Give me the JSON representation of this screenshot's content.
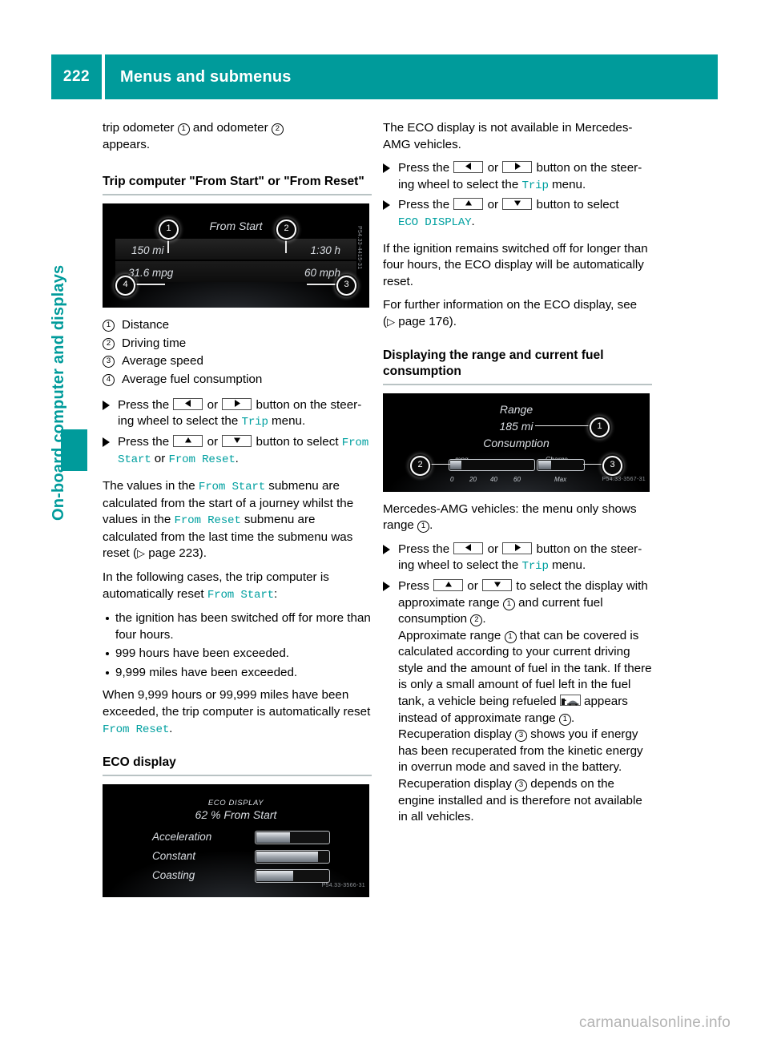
{
  "header": {
    "page_number": "222",
    "title": "Menus and submenus"
  },
  "side_tab": {
    "label": "On-board computer and displays"
  },
  "footer": {
    "watermark": "carmanualsonline.info"
  },
  "left_column": {
    "intro": {
      "part1": "trip odometer ",
      "marker1": "1",
      "part2": " and odometer ",
      "marker2": "2",
      "part3": "",
      "line2": "appears."
    },
    "heading_trip": "Trip computer \"From Start\" or \"From Reset\"",
    "trip_shot": {
      "title": "From Start",
      "distance": "150 mi",
      "time": "1:30 h",
      "economy": "31.6 mpg",
      "speed": "60 mph",
      "bubble_1": "1",
      "bubble_2": "2",
      "bubble_3": "3",
      "bubble_4": "4",
      "image_id": "P54.33-4415-31"
    },
    "legend": [
      {
        "marker": "1",
        "label": "Distance"
      },
      {
        "marker": "2",
        "label": "Driving time"
      },
      {
        "marker": "3",
        "label": "Average speed"
      },
      {
        "marker": "4",
        "label": "Average fuel consumption"
      }
    ],
    "step_trip_menu": {
      "t1": "Press the ",
      "t2": " or ",
      "t3": " button on the steer-ing wheel to select the ",
      "menu": "Trip",
      "t4": " menu."
    },
    "step_trip_select": {
      "t1": "Press the ",
      "t2": " or ",
      "t3": " button to select ",
      "menu1": "From Start",
      "t4": " or ",
      "menu2": "From Reset",
      "t5": "."
    },
    "para_values": {
      "t1": "The values in the ",
      "m1": "From Start",
      "t2": " submenu are calculated from the start of a journey whilst the values in the ",
      "m2": "From Reset",
      "t3": " submenu are calculated from the last time the submenu was reset (",
      "ref": "page 223",
      "t4": ")."
    },
    "para_cases": {
      "t1": "In the following cases, the trip computer is automatically reset ",
      "m1": "From Start",
      "t2": ":"
    },
    "bullets": [
      "the ignition has been switched off for more than four hours.",
      "999 hours have been exceeded.",
      "9,999 miles have been exceeded."
    ],
    "para_when": {
      "t1": "When 9,999 hours or 99,999 miles have been exceeded, the trip computer is automatically reset ",
      "m1": "From Reset",
      "t2": "."
    },
    "heading_eco": "ECO display",
    "eco_shot": {
      "title": "ECO DISPLAY",
      "subtitle": "62 % From Start",
      "rows": [
        {
          "label": "Acceleration",
          "fill_percent": 46
        },
        {
          "label": "Constant",
          "fill_percent": 84
        },
        {
          "label": "Coasting",
          "fill_percent": 50
        }
      ],
      "image_id": "P54.33-3566-31"
    }
  },
  "right_column": {
    "para_amg": "The ECO display is not available in Mercedes-AMG vehicles.",
    "step_trip_menu": {
      "t1": "Press the ",
      "t2": " or ",
      "t3": " button on the steer-ing wheel to select the ",
      "menu": "Trip",
      "t4": " menu."
    },
    "step_eco_select": {
      "t1": "Press the ",
      "t2": " or ",
      "t3": " button to select ",
      "menu": "ECO DISPLAY",
      "t4": "."
    },
    "para_ignition": "If the ignition remains switched off for longer than four hours, the ECO display will be automatically reset.",
    "para_further": {
      "t1": "For further information on the ECO display, see (",
      "ref": "page 176",
      "t2": ")."
    },
    "heading_range": "Displaying the range and current fuel consumption",
    "range_shot": {
      "title": "Range",
      "value": "185 mi",
      "consumption_label": "Consumption",
      "unit_left": "mpg",
      "unit_right": "Charge",
      "max_label": "Max",
      "ticks": [
        "0",
        "20",
        "40",
        "60"
      ],
      "bubble_1": "1",
      "bubble_2": "2",
      "bubble_3": "3",
      "image_id": "P54.33-3567-31"
    },
    "para_amg_range": {
      "t1": "Mercedes-AMG vehicles: the menu only shows range ",
      "m1": "1",
      "t2": "."
    },
    "step_trip_menu_2": {
      "t1": "Press the ",
      "t2": " or ",
      "t3": " button on the steer-ing wheel to select the ",
      "menu": "Trip",
      "t4": " menu."
    },
    "step_select_display": {
      "t1": "Press ",
      "t2": " or ",
      "t3": " to select the display with approximate range ",
      "m1": "1",
      "t4": " and current fuel consumption ",
      "m2": "2",
      "t5": "."
    },
    "para_approx": {
      "t1": "Approximate range ",
      "m1": "1",
      "t2": " that can be covered is calculated according to your current driving style and the amount of fuel in the tank. If there is only a small amount of fuel left in the fuel tank, a vehicle being refueled ",
      "icon": "refuel-vehicle-icon",
      "t3": " appears instead of approximate range ",
      "m2": "1",
      "t4": "."
    },
    "para_recup": {
      "t1": "Recuperation display ",
      "m1": "3",
      "t2": " shows you if energy has been recuperated from the kinetic energy in overrun mode and saved in the battery. Recuperation display ",
      "m2": "3",
      "t3": " depends on the engine installed and is therefore not available in all vehicles."
    }
  },
  "colors": {
    "teal": "#009b9b",
    "mono_teal": "#00a0a0",
    "rule": "#b9c3c4"
  }
}
